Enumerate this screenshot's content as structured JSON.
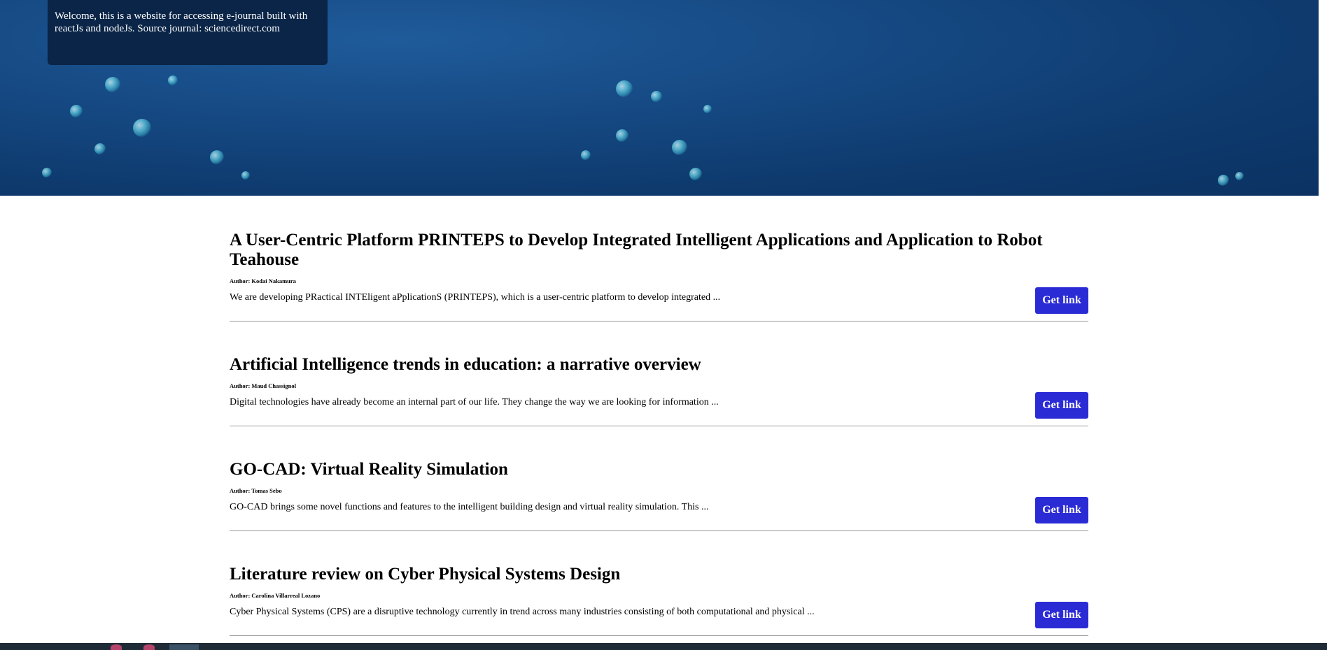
{
  "hero": {
    "welcome_text": "Welcome, this is a website for accessing e-journal built with reactJs and nodeJs. Source journal: sciencedirect.com"
  },
  "articles": [
    {
      "title": "A User-Centric Platform PRINTEPS to Develop Integrated Intelligent Applications and Application to Robot Teahouse",
      "author": "Author: Kodai Nakamura",
      "abstract": "We are developing PRactical INTEligent aPplicationS (PRINTEPS), which is a user-centric platform to develop integrated ...",
      "button_label": "Get link"
    },
    {
      "title": "Artificial Intelligence trends in education: a narrative overview",
      "author": "Author: Maud Chassignol",
      "abstract": "Digital technologies have already become an internal part of our life. They change the way we are looking for information ...",
      "button_label": "Get link"
    },
    {
      "title": "GO-CAD: Virtual Reality Simulation",
      "author": "Author: Tomas Sebo",
      "abstract": "GO-CAD brings some novel functions and features to the intelligent building design and virtual reality simulation. This ...",
      "button_label": "Get link"
    },
    {
      "title": "Literature review on Cyber Physical Systems Design",
      "author": "Author: Carolina Villarreal Lozano",
      "abstract": "Cyber Physical Systems (CPS) are a disruptive technology currently in trend across many industries consisting of both computational and physical ...",
      "button_label": "Get link"
    }
  ],
  "colors": {
    "hero_background": "#164a84",
    "welcome_box": "#0a2547",
    "button": "#2b2bd6",
    "divider": "#9a9a9a"
  }
}
